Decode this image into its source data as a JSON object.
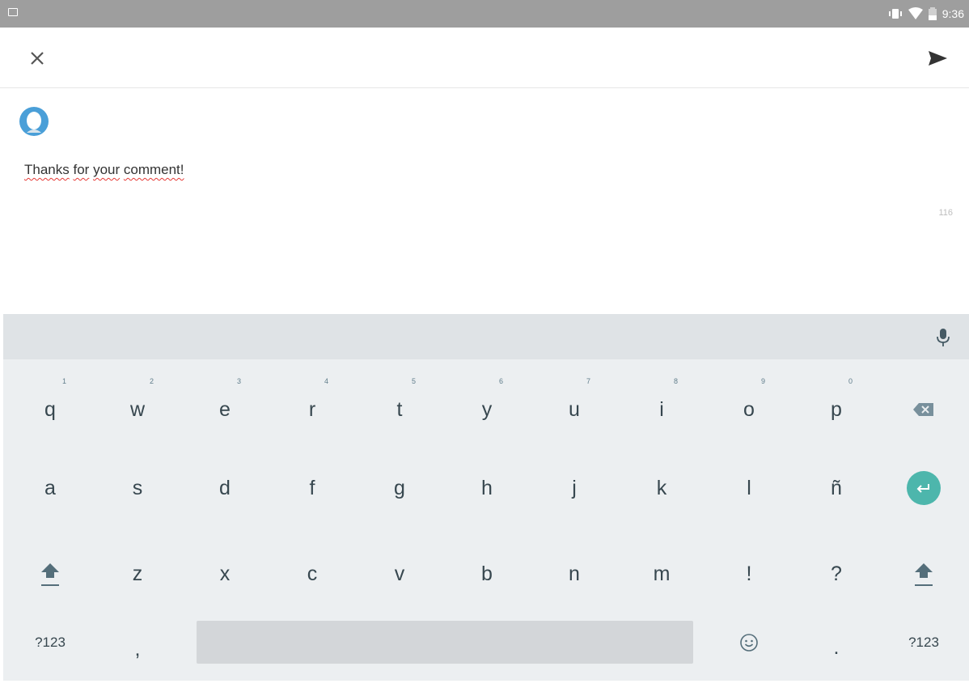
{
  "status_bar": {
    "time": "9:36"
  },
  "app_bar": {
    "close_icon": "close-icon",
    "send_icon": "send-icon"
  },
  "compose": {
    "text_words": [
      "Thanks",
      "for",
      "your",
      "comment!"
    ],
    "char_count": "116"
  },
  "keyboard": {
    "row1": [
      {
        "label": "q",
        "hint": "1"
      },
      {
        "label": "w",
        "hint": "2"
      },
      {
        "label": "e",
        "hint": "3"
      },
      {
        "label": "r",
        "hint": "4"
      },
      {
        "label": "t",
        "hint": "5"
      },
      {
        "label": "y",
        "hint": "6"
      },
      {
        "label": "u",
        "hint": "7"
      },
      {
        "label": "i",
        "hint": "8"
      },
      {
        "label": "o",
        "hint": "9"
      },
      {
        "label": "p",
        "hint": "0"
      }
    ],
    "row2": [
      "a",
      "s",
      "d",
      "f",
      "g",
      "h",
      "j",
      "k",
      "l",
      "ñ"
    ],
    "row3": [
      "z",
      "x",
      "c",
      "v",
      "b",
      "n",
      "m",
      "!",
      "?"
    ],
    "row4": {
      "symbols_left": "?123",
      "comma": ",",
      "period": ".",
      "symbols_right": "?123"
    },
    "accent_color": "#4db6ac"
  }
}
